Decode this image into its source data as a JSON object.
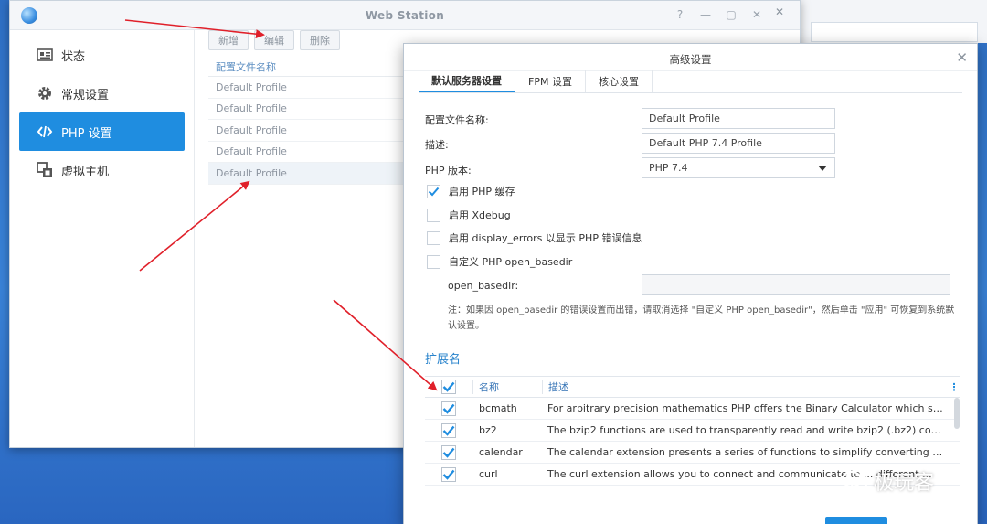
{
  "window": {
    "title": "Web Station",
    "controls": [
      "?",
      "—",
      "▢",
      "✕"
    ]
  },
  "sidebar": {
    "items": [
      {
        "label": "状态",
        "icon": "status-card-icon"
      },
      {
        "label": "常规设置",
        "icon": "gear-icon"
      },
      {
        "label": "PHP 设置",
        "icon": "code-brackets-icon",
        "active": true
      },
      {
        "label": "虚拟主机",
        "icon": "virtual-host-icon"
      }
    ]
  },
  "toolbar": {
    "add_label": "新增",
    "edit_label": "编辑",
    "delete_label": "删除"
  },
  "profile_table": {
    "header": "配置文件名称",
    "rows": [
      "Default Profile",
      "Default Profile",
      "Default Profile",
      "Default Profile",
      "Default Profile"
    ]
  },
  "dialog": {
    "title": "高级设置",
    "tabs": [
      "默认服务器设置",
      "FPM 设置",
      "核心设置"
    ],
    "profile_name_label": "配置文件名称:",
    "profile_name_value": "Default Profile",
    "description_label": "描述:",
    "description_value": "Default PHP 7.4 Profile",
    "php_version_label": "PHP 版本:",
    "php_version_value": "PHP 7.4",
    "checkboxes": [
      {
        "label": "启用 PHP 缓存",
        "checked": true
      },
      {
        "label": "启用 Xdebug",
        "checked": false
      },
      {
        "label": "启用 display_errors 以显示 PHP 错误信息",
        "checked": false
      },
      {
        "label": "自定义 PHP open_basedir",
        "checked": false
      }
    ],
    "open_basedir_label": "open_basedir:",
    "open_basedir_value": "",
    "note": "注：如果因 open_basedir 的错误设置而出错，请取消选择 \"自定义 PHP open_basedir\"，然后单击 \"应用\" 可恢复到系统默认设置。",
    "extensions_title": "扩展名",
    "extensions_header": {
      "name": "名称",
      "description": "描述"
    },
    "extensions": [
      {
        "name": "bcmath",
        "description": "For arbitrary precision mathematics PHP offers the Binary Calculator which supp..."
      },
      {
        "name": "bz2",
        "description": "The bzip2 functions are used to transparently read and write bzip2 (.bz2) compr..."
      },
      {
        "name": "calendar",
        "description": "The calendar extension presents a series of functions to simplify converting bet..."
      },
      {
        "name": "curl",
        "description": "The curl extension allows you to connect and communicate to ... different ..."
      }
    ]
  },
  "watermark": {
    "text": "极玩客"
  },
  "colors": {
    "accent": "#1f8de0",
    "arrow": "#e0202a"
  }
}
